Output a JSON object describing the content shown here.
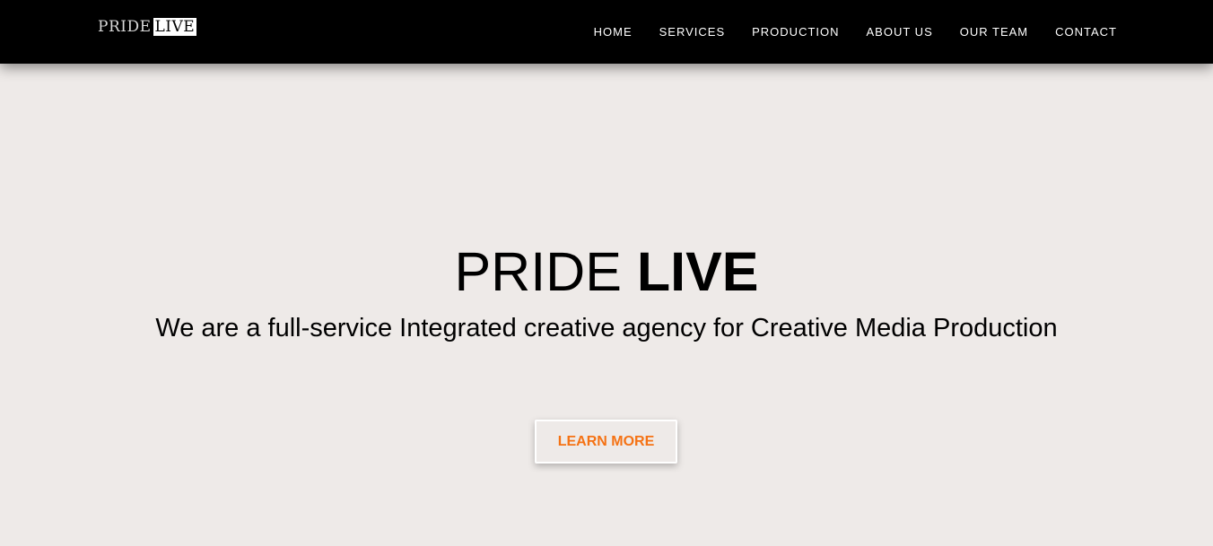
{
  "logo": {
    "part1": "PRIDE",
    "part2": "LIVE"
  },
  "nav": {
    "items": [
      "HOME",
      "SERVICES",
      "PRODUCTION",
      "ABOUT US",
      "OUR TEAM",
      "CONTACT"
    ]
  },
  "hero": {
    "title_light": "PRIDE",
    "title_bold": "LIVE",
    "subtitle": "We are a full-service Integrated creative agency for Creative Media Production",
    "button_label": "LEARN MORE"
  },
  "colors": {
    "navbar_bg": "#000000",
    "page_bg": "#eeeae8",
    "accent": "#f57214"
  }
}
